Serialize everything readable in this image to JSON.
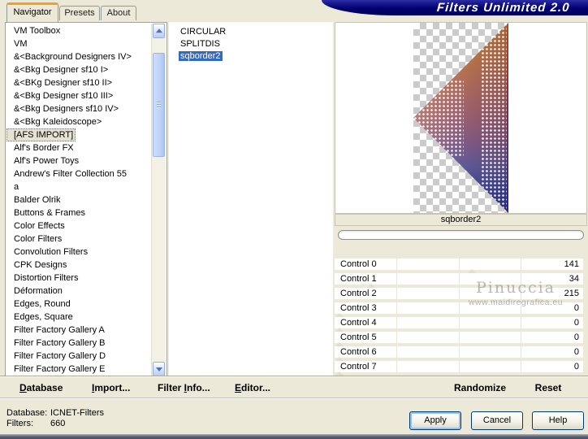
{
  "window": {
    "app_title": "Filters Unlimited 2.0"
  },
  "tabs": [
    {
      "label": "Navigator",
      "active": true
    },
    {
      "label": "Presets",
      "active": false
    },
    {
      "label": "About",
      "active": false
    }
  ],
  "category_list": {
    "selected": "[AFS IMPORT]",
    "items": [
      "VM Toolbox",
      "VM",
      "&<Background Designers IV>",
      "&<Bkg Designer sf10 I>",
      "&<BKg Designer sf10 II>",
      "&<Bkg Designer sf10 III>",
      "&<Bkg Designers sf10 IV>",
      "&<Bkg Kaleidoscope>",
      "[AFS IMPORT]",
      "Alf's Border FX",
      "Alf's Power Toys",
      "Andrew's Filter Collection 55",
      "a",
      "Balder Olrik",
      "Buttons & Frames",
      "Color Effects",
      "Color Filters",
      "Convolution Filters",
      "CPK Designs",
      "Distortion Filters",
      "Déformation",
      "Edges, Round",
      "Edges, Square",
      "Filter Factory Gallery A",
      "Filter Factory Gallery B",
      "Filter Factory Gallery D",
      "Filter Factory Gallery E"
    ]
  },
  "filter_list": {
    "selected": "sqborder2",
    "items": [
      "CIRCULAR",
      "SPLITDIS",
      "sqborder2"
    ]
  },
  "preview": {
    "filter_name": "sqborder2"
  },
  "controls": {
    "max": 255,
    "items": [
      {
        "label": "Control 0",
        "value": 141
      },
      {
        "label": "Control 1",
        "value": 34
      },
      {
        "label": "Control 2",
        "value": 215
      },
      {
        "label": "Control 3",
        "value": 0
      },
      {
        "label": "Control 4",
        "value": 0
      },
      {
        "label": "Control 5",
        "value": 0
      },
      {
        "label": "Control 6",
        "value": 0
      },
      {
        "label": "Control 7",
        "value": 0
      }
    ]
  },
  "toolbar": {
    "items": [
      {
        "id": "database",
        "label": "Database",
        "accel": 0
      },
      {
        "id": "import",
        "label": "Import...",
        "accel": 0
      },
      {
        "id": "filter-info",
        "label": "Filter Info...",
        "accel": 7
      },
      {
        "id": "editor",
        "label": "Editor...",
        "accel": 0
      },
      {
        "id": "randomize",
        "label": "Randomize",
        "accel": null
      },
      {
        "id": "reset",
        "label": "Reset",
        "accel": null
      }
    ]
  },
  "status": {
    "database_label": "Database:",
    "database_value": "ICNET-Filters",
    "filters_label": "Filters:",
    "filters_value": "660"
  },
  "action_buttons": {
    "apply": "Apply",
    "cancel": "Cancel",
    "help": "Help"
  },
  "watermark": {
    "line1": "Pinuccia",
    "line2": "www.maidiregrafica.eu"
  },
  "colors": {
    "background": "#ECE9D8",
    "banner": "#000066",
    "tab_accent": "#F59E27",
    "selection_blue": "#316AC5"
  }
}
